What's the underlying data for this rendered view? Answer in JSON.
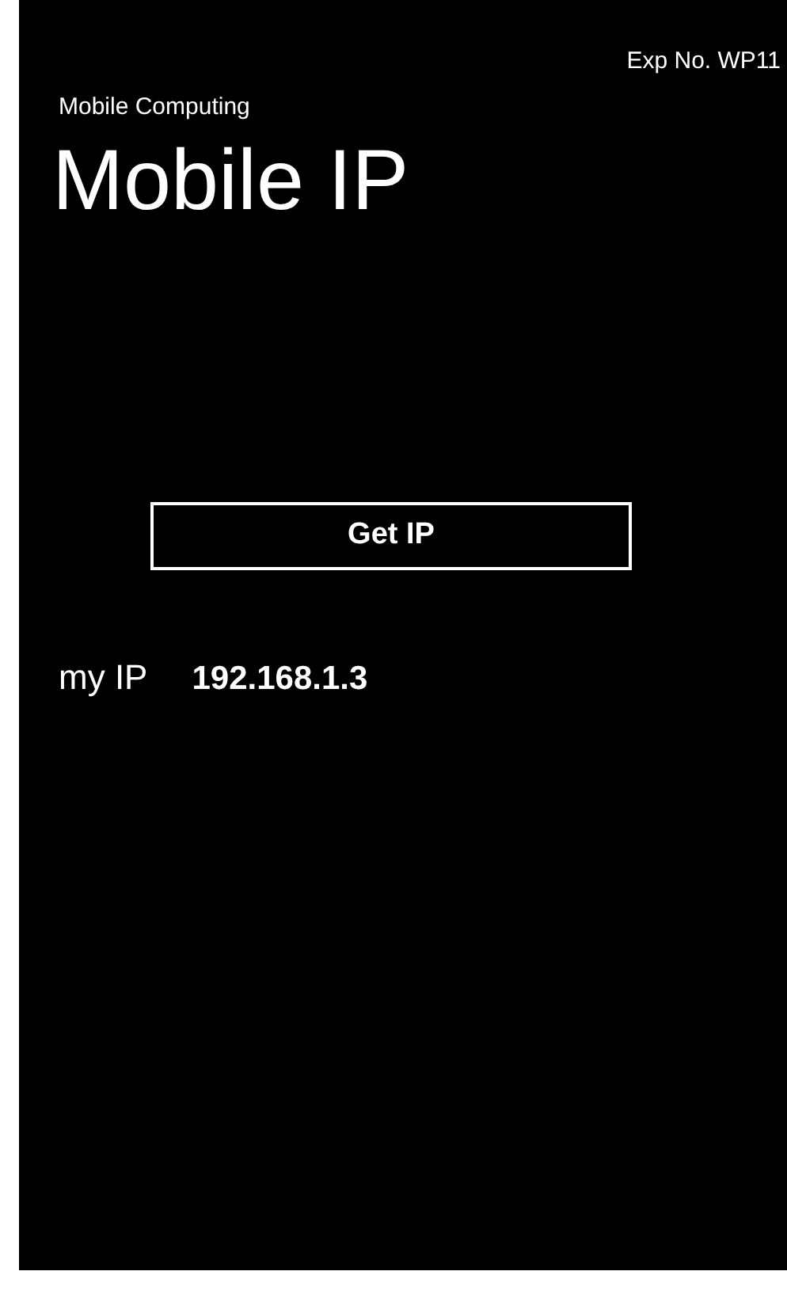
{
  "header": {
    "experiment": "Exp No. WP11",
    "app_title": "Mobile Computing",
    "page_title": "Mobile IP"
  },
  "button": {
    "label": "Get IP"
  },
  "result": {
    "label": "my IP",
    "value": "192.168.1.3"
  }
}
